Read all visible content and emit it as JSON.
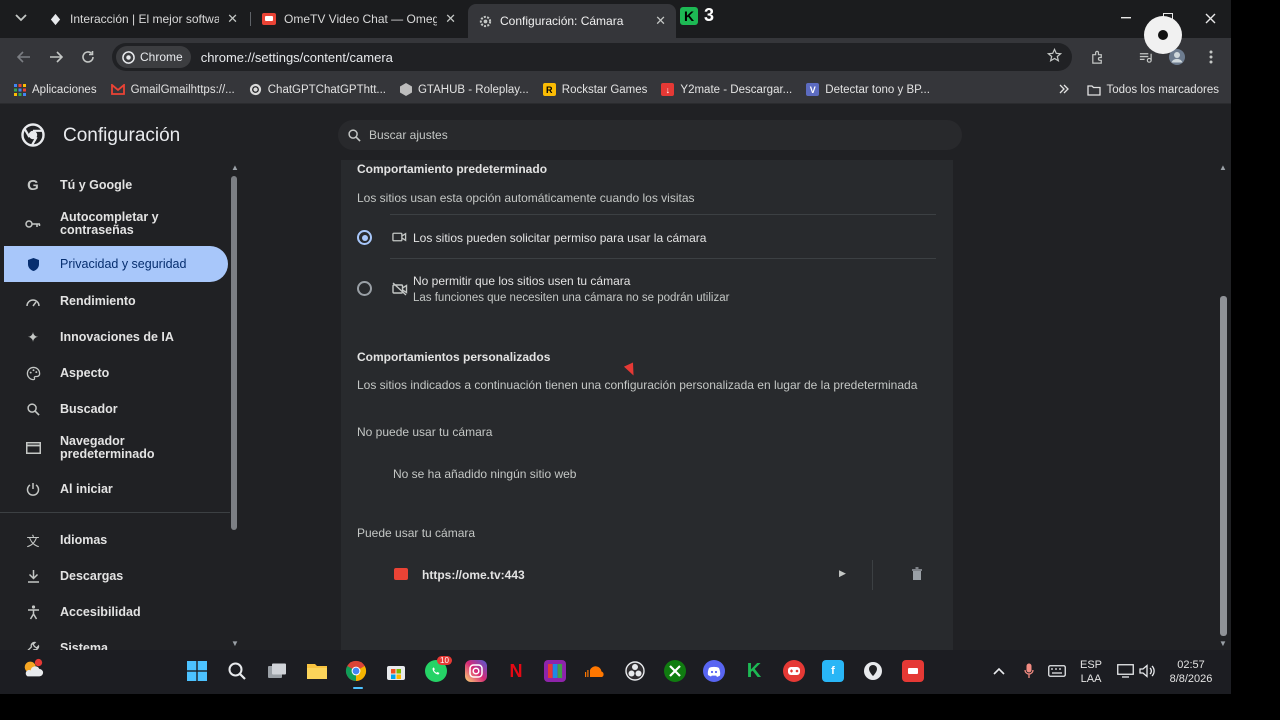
{
  "tabs": [
    {
      "title": "Interacción | El mejor software p",
      "favicon": "gear-dark-icon",
      "active": false
    },
    {
      "title": "OmeTV Video Chat — Omegle",
      "favicon": "ometv-icon",
      "active": false
    },
    {
      "title": "Configuración: Cámara",
      "favicon": "settings-gear-icon",
      "active": true
    }
  ],
  "k_app": {
    "badge": "K",
    "count": "3"
  },
  "toolbar": {
    "chip_label": "Chrome",
    "url": "chrome://settings/content/camera"
  },
  "bookmarks": {
    "items": [
      {
        "label": "Aplicaciones",
        "color": "#4285f4"
      },
      {
        "label": "GmailGmailhttps://...",
        "color": "#ea4335"
      },
      {
        "label": "ChatGPTChatGPThtt...",
        "color": "#9e9e9e"
      },
      {
        "label": "GTAHUB - Roleplay...",
        "color": "#bdbdbd"
      },
      {
        "label": "Rockstar Games",
        "color": "#fbbc04"
      },
      {
        "label": "Y2mate - Descargar...",
        "color": "#e53935"
      },
      {
        "label": "Detectar tono y BP...",
        "color": "#5c6bc0"
      }
    ],
    "all_label": "Todos los marcadores"
  },
  "settings": {
    "title": "Configuración",
    "search_placeholder": "Buscar ajustes"
  },
  "sidebar": {
    "items": [
      {
        "label": "Tú y Google",
        "icon": "google-icon"
      },
      {
        "label": "Autocompletar y contraseñas",
        "icon": "key-icon"
      },
      {
        "label": "Privacidad y seguridad",
        "icon": "shield-icon",
        "selected": true
      },
      {
        "label": "Rendimiento",
        "icon": "speedometer-icon"
      },
      {
        "label": "Innovaciones de IA",
        "icon": "sparkle-icon"
      },
      {
        "label": "Aspecto",
        "icon": "palette-icon"
      },
      {
        "label": "Buscador",
        "icon": "search-icon"
      },
      {
        "label": "Navegador predeterminado",
        "icon": "browser-icon"
      },
      {
        "label": "Al iniciar",
        "icon": "power-icon"
      },
      {
        "label": "Idiomas",
        "icon": "translate-icon"
      },
      {
        "label": "Descargas",
        "icon": "download-icon"
      },
      {
        "label": "Accesibilidad",
        "icon": "accessibility-icon"
      },
      {
        "label": "Sistema",
        "icon": "wrench-icon"
      }
    ]
  },
  "content": {
    "default_heading": "Comportamiento predeterminado",
    "default_desc": "Los sitios usan esta opción automáticamente cuando los visitas",
    "option_allow": "Los sitios pueden solicitar permiso para usar la cámara",
    "option_block": "No permitir que los sitios usen tu cámara",
    "option_block_sub": "Las funciones que necesiten una cámara no se podrán utilizar",
    "custom_heading": "Comportamientos personalizados",
    "custom_desc": "Los sitios indicados a continuación tienen una configuración personalizada en lugar de la predeterminada",
    "blocked_heading": "No puede usar tu cámara",
    "blocked_empty": "No se ha añadido ningún sitio web",
    "allowed_heading": "Puede usar tu cámara",
    "allowed_site": "https://ome.tv:443"
  },
  "taskbar": {
    "whatsapp_badge": "10",
    "lang": "ESP",
    "lang_sub": "LAA",
    "time": "02:57",
    "date": "8/8/2026"
  }
}
